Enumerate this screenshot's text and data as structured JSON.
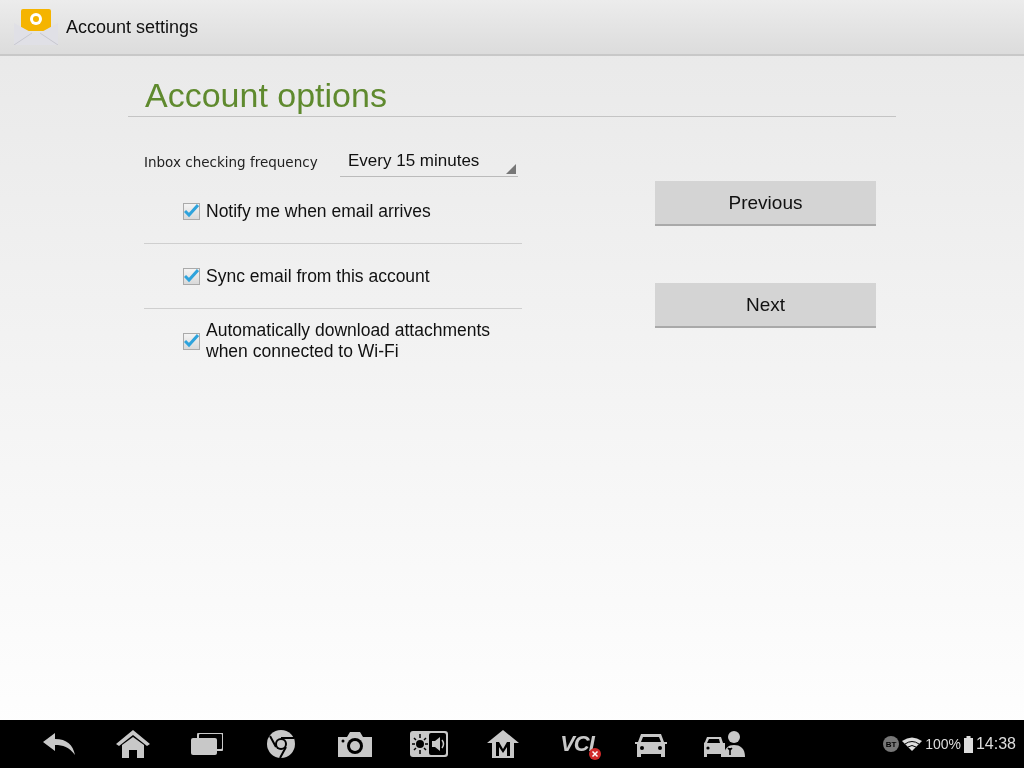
{
  "action_bar": {
    "title": "Account settings"
  },
  "section": {
    "title": "Account options"
  },
  "frequency": {
    "label": "Inbox checking frequency",
    "value": "Every 15 minutes"
  },
  "options": [
    {
      "label": "Notify me when email arrives",
      "checked": true
    },
    {
      "label": "Sync email from this account",
      "checked": true
    },
    {
      "label": "Automatically download attachments when connected to Wi-Fi",
      "checked": true
    }
  ],
  "buttons": [
    "Previous",
    "Next"
  ],
  "taskbar": {
    "items": [
      {
        "kind": "back"
      },
      {
        "kind": "home"
      },
      {
        "kind": "recents"
      },
      {
        "kind": "browser"
      },
      {
        "kind": "camera"
      },
      {
        "kind": "display"
      },
      {
        "kind": "shop"
      },
      {
        "kind": "vci",
        "label": "VCI"
      },
      {
        "kind": "car"
      },
      {
        "kind": "service"
      }
    ],
    "status": {
      "bluetooth": "BT",
      "battery": "100%",
      "time": "14:38"
    }
  }
}
